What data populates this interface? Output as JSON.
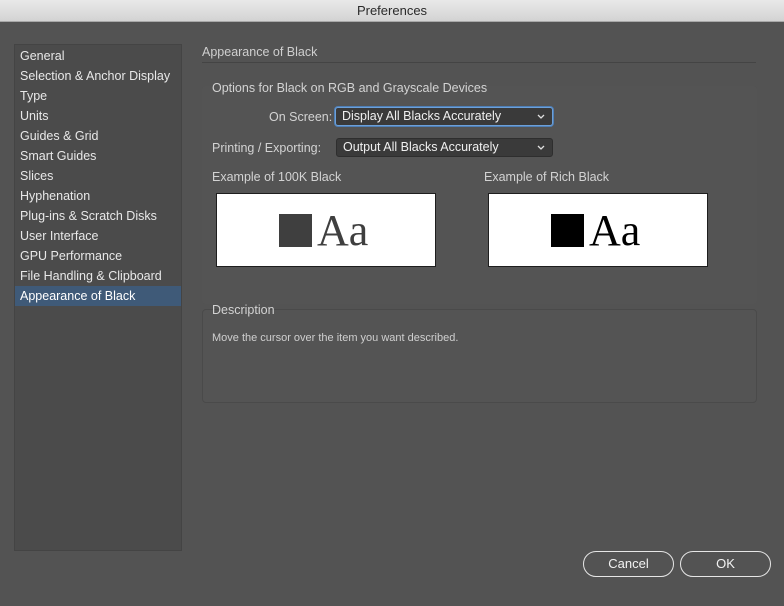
{
  "window": {
    "title": "Preferences"
  },
  "sidebar": {
    "items": [
      {
        "label": "General",
        "selected": false
      },
      {
        "label": "Selection & Anchor Display",
        "selected": false
      },
      {
        "label": "Type",
        "selected": false
      },
      {
        "label": "Units",
        "selected": false
      },
      {
        "label": "Guides & Grid",
        "selected": false
      },
      {
        "label": "Smart Guides",
        "selected": false
      },
      {
        "label": "Slices",
        "selected": false
      },
      {
        "label": "Hyphenation",
        "selected": false
      },
      {
        "label": "Plug-ins & Scratch Disks",
        "selected": false
      },
      {
        "label": "User Interface",
        "selected": false
      },
      {
        "label": "GPU Performance",
        "selected": false
      },
      {
        "label": "File Handling & Clipboard",
        "selected": false
      },
      {
        "label": "Appearance of Black",
        "selected": true
      }
    ]
  },
  "main": {
    "section_title": "Appearance of Black",
    "options": {
      "title": "Options for Black on RGB and Grayscale Devices",
      "on_screen_label": "On Screen:",
      "on_screen_value": "Display All Blacks Accurately",
      "printing_label": "Printing / Exporting:",
      "printing_value": "Output All Blacks Accurately",
      "example_100k_label": "Example of 100K Black",
      "example_rich_label": "Example of Rich Black",
      "sample_text": "Aa"
    },
    "description": {
      "title": "Description",
      "text": "Move the cursor over the item you want described."
    }
  },
  "buttons": {
    "cancel": "Cancel",
    "ok": "OK"
  },
  "colors": {
    "selection": "#3f5a78",
    "black_100k": "#3f3f3f",
    "black_rich": "#000000"
  }
}
